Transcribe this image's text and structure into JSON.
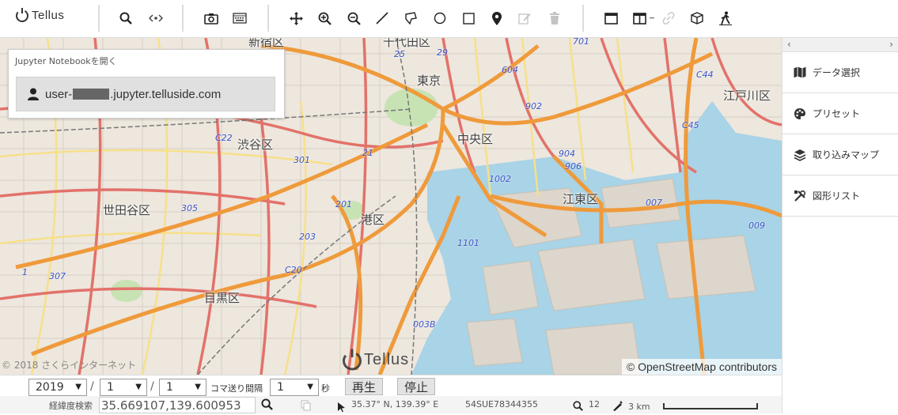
{
  "app": {
    "logo_text": "Tellus"
  },
  "toolbar": {
    "icons": [
      "search-icon",
      "code-icon",
      "camera-icon",
      "keyboard-icon",
      "move-icon",
      "zoom-in-icon",
      "zoom-out-icon",
      "line-icon",
      "polygon-icon",
      "circle-icon",
      "square-icon",
      "marker-icon",
      "edit-icon",
      "trash-icon",
      "single-pane-icon",
      "split-pane-icon",
      "link-icon",
      "cube-icon",
      "walk-icon"
    ]
  },
  "notebook_panel": {
    "title": "Jupyter Notebookを開く",
    "user_prefix": "user-",
    "user_suffix": ".jupyter.telluside.com"
  },
  "map": {
    "place_labels": [
      "新宿区",
      "千代田区",
      "東京",
      "中央区",
      "渋谷区",
      "江東区",
      "世田谷区",
      "港区",
      "目黒区",
      "江戸川区"
    ],
    "route_labels": [
      "25",
      "29",
      "604",
      "701",
      "902",
      "C44",
      "C22",
      "301",
      "21",
      "904",
      "906",
      "1002",
      "C45",
      "305",
      "201",
      "007",
      "203",
      "009",
      "1101",
      "C20",
      "307",
      "003B",
      "1"
    ],
    "copyright": "© 2018 さくらインターネット",
    "watermark": "Tellus",
    "attribution": "© OpenStreetMap contributors"
  },
  "sidebar": {
    "items": [
      {
        "label": "データ選択",
        "icon": "map-icon"
      },
      {
        "label": "プリセット",
        "icon": "palette-icon"
      },
      {
        "label": "取り込みマップ",
        "icon": "layers-icon"
      },
      {
        "label": "図形リスト",
        "icon": "tools-icon"
      }
    ]
  },
  "playback": {
    "year": "2019",
    "month": "1",
    "day": "1",
    "frame_interval_label": "コマ送り間隔",
    "interval": "1",
    "seconds_label": "秒",
    "play_label": "再生",
    "stop_label": "停止"
  },
  "statusbar": {
    "coord_search_label": "経緯度検索",
    "coord_value": "35.669107,139.600953",
    "cursor_latlon": "35.37° N, 139.39° E",
    "mgrs": "54SUE78344355",
    "zoom": "12",
    "scale": "3 km"
  }
}
